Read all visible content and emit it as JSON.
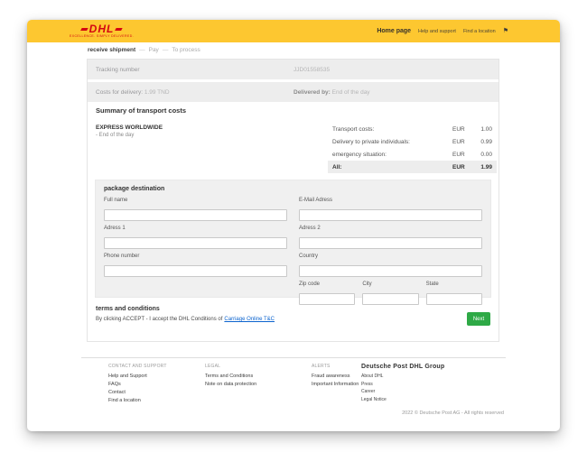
{
  "colors": {
    "dhl_yellow": "#FDC730",
    "dhl_red": "#D40511",
    "accent_green": "#2EA946",
    "link_blue": "#0B63CE",
    "row_gray": "#EDEDED",
    "form_gray": "#F0F0F0"
  },
  "header": {
    "logo_text": "DHL",
    "logo_tagline": "EXCELLENCE. SIMPLY DELIVERED.",
    "nav_home": "Home page",
    "nav_help": "Help and support",
    "nav_location": "Find a location",
    "flag_icon": "⚑"
  },
  "breadcrumb": {
    "current": "receive shipment",
    "sep1": "—",
    "step_pay": "Pay",
    "sep2": "—",
    "step_process": "To process"
  },
  "shipment": {
    "tracking_label": "Tracking number",
    "tracking_value": "JJD01558535",
    "costs_label": "Costs for delivery:",
    "costs_value": "1.99 TND",
    "delivered_label": "Delivered by:",
    "delivered_value": "End of the day"
  },
  "summary": {
    "title": "Summary of transport costs",
    "service_name": "EXPRESS WORLDWIDE",
    "service_detail": "- End of the day",
    "lines": [
      {
        "label": "Transport costs:",
        "currency": "EUR",
        "amount": "1.00"
      },
      {
        "label": "Delivery to private individuals:",
        "currency": "EUR",
        "amount": "0.99"
      },
      {
        "label": "emergency situation:",
        "currency": "EUR",
        "amount": "0.00"
      },
      {
        "label": "All:",
        "currency": "EUR",
        "amount": "1.99"
      }
    ]
  },
  "form": {
    "title": "package destination",
    "full_name": "Full name",
    "email": "E-Mail Adress",
    "adress1": "Adress 1",
    "adress2": "Adress 2",
    "phone": "Phone number",
    "country": "Country",
    "zip": "Zip code",
    "city": "City",
    "state": "State"
  },
  "terms": {
    "title": "terms and conditions",
    "text": "By clicking ACCEPT - I accept the DHL Conditions of",
    "link": "Carriage Online T&C",
    "next_button": "Next"
  },
  "footer": {
    "col1": {
      "heading": "CONTACT AND SUPPORT",
      "links": [
        "Help and Support",
        "FAQs",
        "Contact",
        "Find a location"
      ]
    },
    "col2": {
      "heading": "LEGAL",
      "links": [
        "Terms and Conditions",
        "Note on data protection"
      ]
    },
    "col3": {
      "heading": "ALERTS",
      "links": [
        "Fraud awareness",
        "Important Information"
      ]
    },
    "col4": {
      "heading": "Deutsche Post DHL Group",
      "links": [
        "About DHL",
        "Press",
        "Career",
        "Legal Notice"
      ]
    },
    "copyright": "2022 © Deutsche Post AG - All rights reserved"
  }
}
